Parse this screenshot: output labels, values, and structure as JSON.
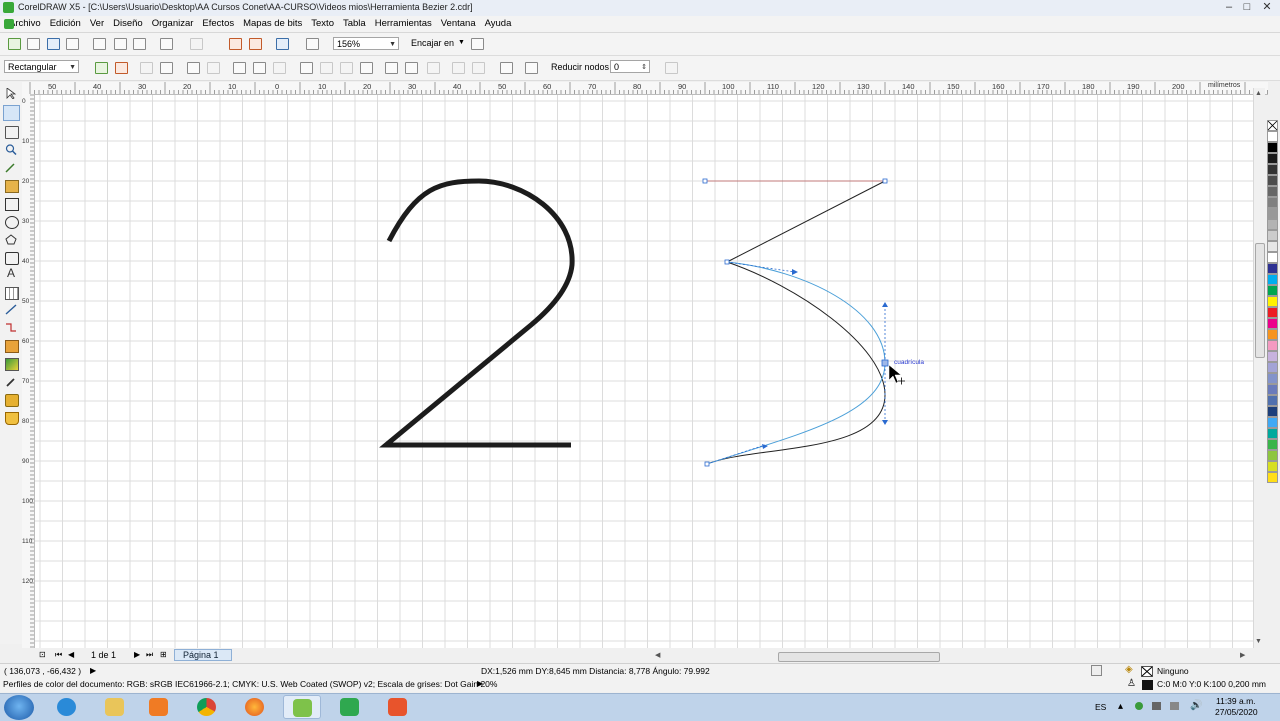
{
  "window": {
    "title": "CorelDRAW X5 - [C:\\Users\\Usuario\\Desktop\\AA Cursos Conet\\AA-CURSO\\Videos mios\\Herramienta Bezier 2.cdr]",
    "controls": [
      "–",
      "□",
      "✕"
    ]
  },
  "menu": {
    "items": [
      "Archivo",
      "Edición",
      "Ver",
      "Diseño",
      "Organizar",
      "Efectos",
      "Mapas de bits",
      "Texto",
      "Tabla",
      "Herramientas",
      "Ventana",
      "Ayuda"
    ]
  },
  "standard_toolbar": {
    "zoom": "156%",
    "snap_label": "Encajar en"
  },
  "property_bar": {
    "selection_mode": "Rectangular",
    "reduce_nodes_label": "Reducir nodos",
    "reduce_nodes_value": "0"
  },
  "rulers": {
    "h_labels": [
      "50",
      "40",
      "30",
      "20",
      "10",
      "0",
      "10",
      "20",
      "30",
      "40",
      "50",
      "60",
      "70",
      "80",
      "90",
      "100",
      "110",
      "120",
      "130",
      "140",
      "150",
      "160",
      "170",
      "180",
      "190",
      "200"
    ],
    "unit": "milímetros",
    "v_labels": [
      "0",
      "10",
      "20",
      "30",
      "40",
      "50",
      "60",
      "70",
      "80",
      "90",
      "100",
      "110",
      "120"
    ]
  },
  "canvas": {
    "snap_tooltip": "cuadrícula"
  },
  "page_nav": {
    "page_count": "1 de 1",
    "page_tab": "Página 1"
  },
  "status": {
    "coords": "( 136,073 , -66,432 )",
    "measure": "DX:1,526 mm DY:8,645 mm Distancia: 8,778 Ángulo: 79.992",
    "color_profile": "Perfiles de color del documento: RGB: sRGB IEC61966-2.1; CMYK: U.S. Web Coated (SWOP) v2; Escala de grises: Dot Gain 20%",
    "fill": "Ninguno",
    "outline": "C:0 M:0 Y:0 K:100  0,200 mm"
  },
  "palette": {
    "colors": [
      "#ffffff",
      "#000000",
      "#1a1a1a",
      "#333333",
      "#4d4d4d",
      "#666666",
      "#808080",
      "#999999",
      "#b3b3b3",
      "#cccccc",
      "#e6e6e6",
      "#ffffff",
      "#2e3192",
      "#00aeef",
      "#00a651",
      "#fff200",
      "#ed1c24",
      "#ec008c",
      "#f7941d",
      "#f49ac1",
      "#c7b2de",
      "#a3a3d6",
      "#8393ca",
      "#6a7bbb",
      "#5070ae",
      "#1d3f7a",
      "#3fa9f5",
      "#00a99d",
      "#39b54a",
      "#8dc63f",
      "#d7df23",
      "#ffde17"
    ]
  },
  "taskbar": {
    "clock_time": "11:39 a.m.",
    "clock_date": "27/05/2020",
    "lang": "ES"
  }
}
